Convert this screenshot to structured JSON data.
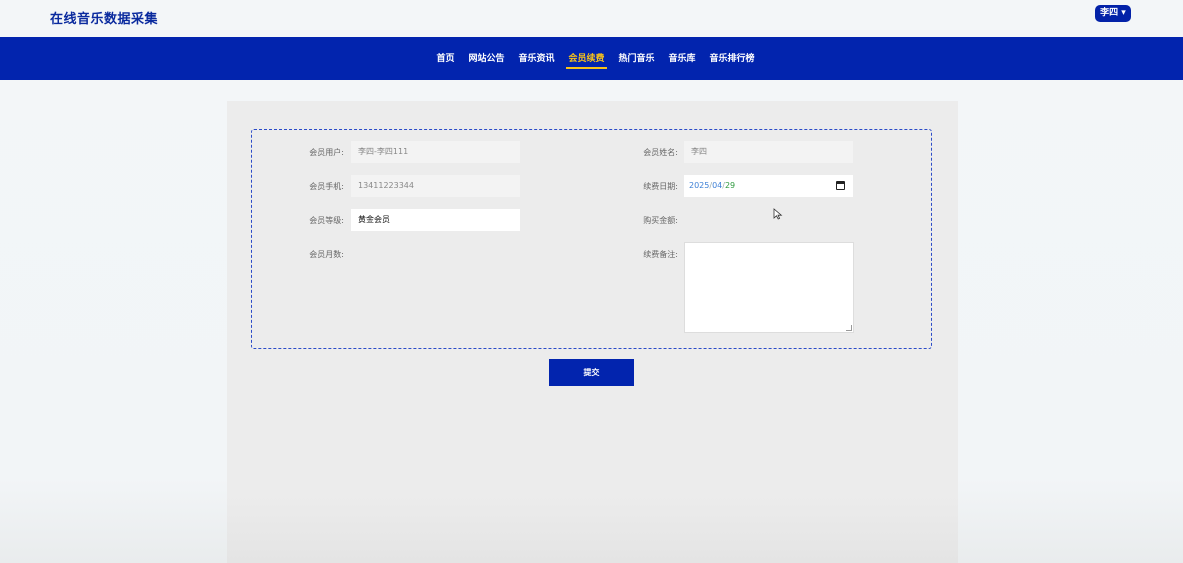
{
  "header": {
    "site_title": "在线音乐数据采集",
    "user_menu_label": "李四 ▾"
  },
  "nav": {
    "items": [
      {
        "label": "首页",
        "active": false
      },
      {
        "label": "网站公告",
        "active": false
      },
      {
        "label": "音乐资讯",
        "active": false
      },
      {
        "label": "会员续费",
        "active": true
      },
      {
        "label": "热门音乐",
        "active": false
      },
      {
        "label": "音乐库",
        "active": false
      },
      {
        "label": "音乐排行榜",
        "active": false
      }
    ]
  },
  "form": {
    "member_user": {
      "label": "会员用户:",
      "value": "李四-李四111"
    },
    "member_name": {
      "label": "会员姓名:",
      "value": "李四"
    },
    "member_phone": {
      "label": "会员手机:",
      "value": "13411223344"
    },
    "renew_date": {
      "label": "续费日期:",
      "year": "2025",
      "month": "04",
      "day": "29",
      "sep": "/"
    },
    "member_level": {
      "label": "会员等级:",
      "value": "黄金会员"
    },
    "purchase_amount": {
      "label": "购买金额:",
      "value": ""
    },
    "member_months": {
      "label": "会员月数:",
      "value": ""
    },
    "renew_note": {
      "label": "续费备注:",
      "value": ""
    },
    "submit_label": "提交"
  },
  "colors": {
    "brand_blue": "#0224ae",
    "nav_active": "#f7c21b",
    "form_border": "#2b4bc8"
  },
  "icons": {
    "calendar": "calendar-icon",
    "cursor": "mouse-pointer-icon"
  }
}
